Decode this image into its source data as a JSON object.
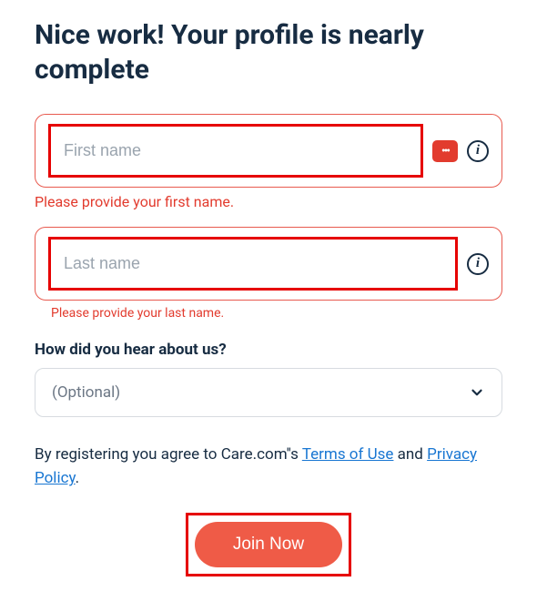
{
  "heading": "Nice work! Your profile is nearly complete",
  "first_name": {
    "placeholder": "First name",
    "value": "",
    "error": "Please provide your first name."
  },
  "last_name": {
    "placeholder": "Last name",
    "value": "",
    "error": "Please provide your last name."
  },
  "hear_about": {
    "label": "How did you hear about us?",
    "selected": "(Optional)"
  },
  "agreement": {
    "prefix": "By registering you agree to Care.com''s ",
    "terms_label": "Terms of Use",
    "mid": " and ",
    "privacy_label": "Privacy Policy",
    "suffix": "."
  },
  "join_label": "Join Now"
}
